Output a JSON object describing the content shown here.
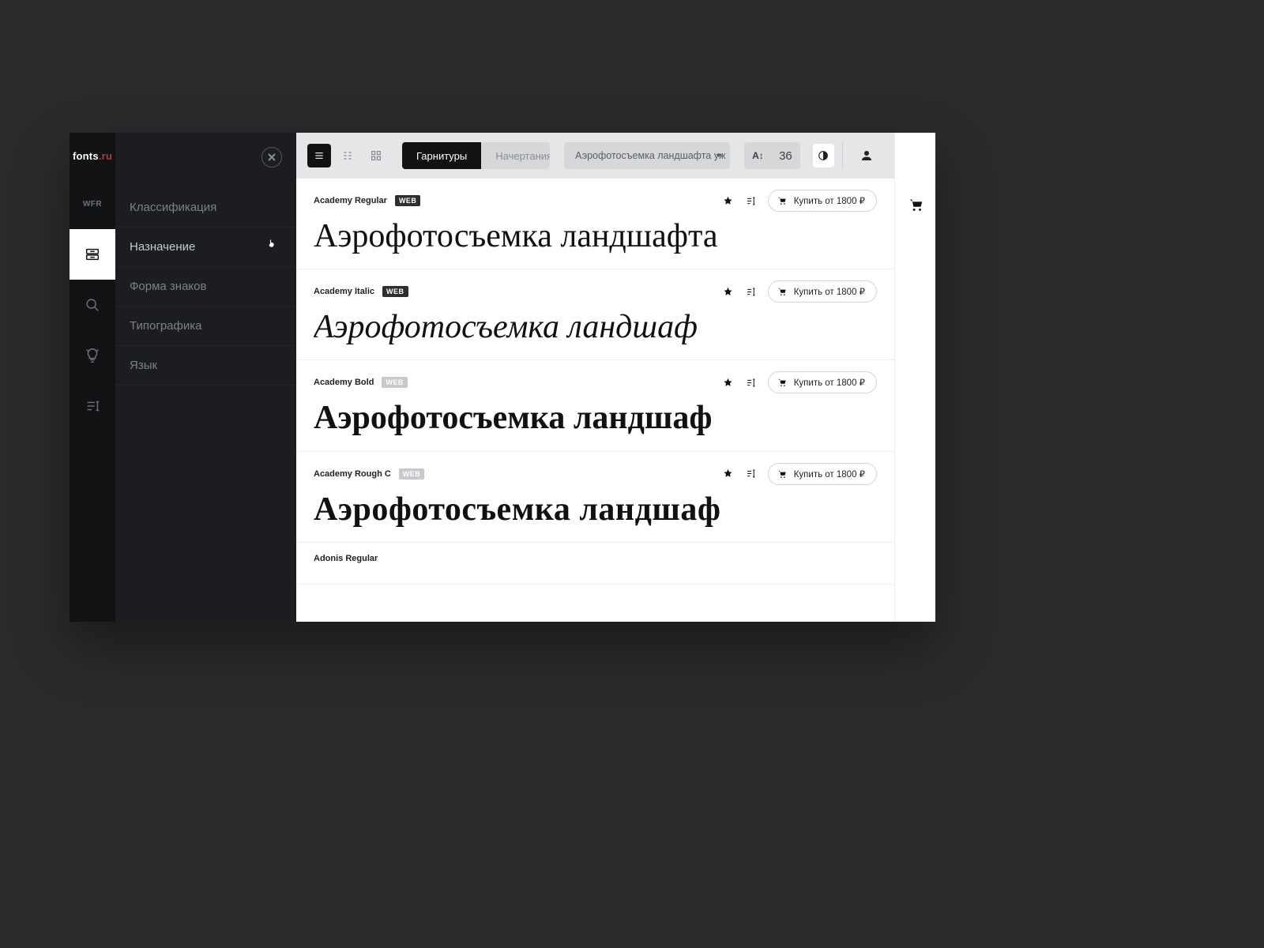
{
  "brand": {
    "name": "fonts",
    "tld": ".ru"
  },
  "sidebar": {
    "items": [
      {
        "label": "Классификация"
      },
      {
        "label": "Назначение"
      },
      {
        "label": "Форма знаков"
      },
      {
        "label": "Типографика"
      },
      {
        "label": "Язык"
      }
    ]
  },
  "toolbar": {
    "tabs": {
      "typefaces": "Гарнитуры",
      "styles": "Начертания"
    },
    "sample_text_short": "Аэрофотосъемка ландшафта уж",
    "size": "36",
    "size_icon": "A↕"
  },
  "fonts": [
    {
      "name": "Academy Regular",
      "badge": "WEB",
      "badge_muted": false,
      "sample": "Аэрофотосъемка ландшафта",
      "style": "regular",
      "buy": "Купить от 1800 ₽"
    },
    {
      "name": "Academy Italic",
      "badge": "WEB",
      "badge_muted": false,
      "sample": "Аэрофотосъемка ландшаф",
      "style": "italic",
      "buy": "Купить от 1800 ₽"
    },
    {
      "name": "Academy Bold",
      "badge": "WEB",
      "badge_muted": true,
      "sample": "Аэрофотосъемка ландшаф",
      "style": "bold",
      "buy": "Купить от 1800 ₽"
    },
    {
      "name": "Academy Rough C",
      "badge": "WEB",
      "badge_muted": true,
      "sample": "Аэрофотосъемка ландшаф",
      "style": "rough",
      "buy": "Купить от 1800 ₽"
    },
    {
      "name": "Adonis Regular",
      "badge": "",
      "badge_muted": false,
      "sample": "",
      "style": "regular",
      "buy": ""
    }
  ]
}
